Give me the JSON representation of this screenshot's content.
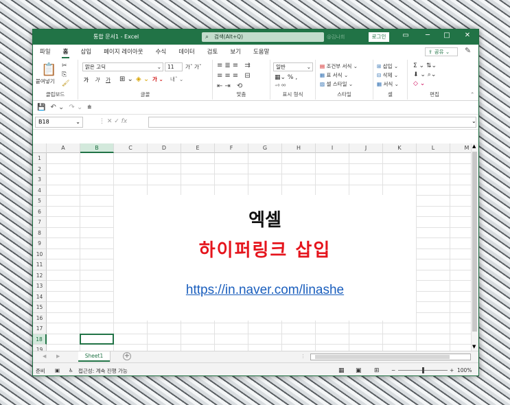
{
  "titlebar": {
    "doc_title": "통합 문서1 - Excel",
    "search_placeholder": "검색(Alt+Q)",
    "user": "@김나희",
    "signin_label": "로그인",
    "minimize": "─",
    "restore": "□",
    "close": "✕"
  },
  "menu": {
    "tabs": [
      "파일",
      "홈",
      "삽입",
      "페이지 레이아웃",
      "수식",
      "데이터",
      "검토",
      "보기",
      "도움말"
    ],
    "active_tab": "홈",
    "share_label": "공유"
  },
  "ribbon": {
    "clipboard": {
      "paste_label": "붙여넣기",
      "group_label": "클립보드"
    },
    "font": {
      "font_name": "맑은 고딕",
      "font_size": "11",
      "bold": "가",
      "italic": "가",
      "underline": "가",
      "group_label": "글꼴"
    },
    "alignment": {
      "group_label": "맞춤"
    },
    "number": {
      "format": "일반",
      "group_label": "표시 형식"
    },
    "styles": {
      "conditional": "조건부 서식",
      "table": "표 서식",
      "cell_styles": "셀 스타일",
      "group_label": "스타일"
    },
    "cells": {
      "insert": "삽입",
      "delete": "삭제",
      "format": "서식",
      "group_label": "셀"
    },
    "editing": {
      "group_label": "편집"
    }
  },
  "formula_bar": {
    "name_box": "B18",
    "fx": "fx",
    "formula": ""
  },
  "grid": {
    "columns": [
      "A",
      "B",
      "C",
      "D",
      "E",
      "F",
      "G",
      "H",
      "I",
      "J",
      "K",
      "L",
      "M"
    ],
    "rows": [
      "1",
      "2",
      "3",
      "4",
      "5",
      "6",
      "7",
      "8",
      "9",
      "10",
      "11",
      "12",
      "13",
      "14",
      "15",
      "16",
      "17",
      "18",
      "19"
    ],
    "selected_column": "B",
    "selected_row": "18"
  },
  "overlay": {
    "title": "엑셀",
    "subtitle": "하이퍼링크 삽입",
    "link": "https://in.naver.com/linashe"
  },
  "sheets": {
    "tabs": [
      "Sheet1"
    ],
    "add_label": "+"
  },
  "status": {
    "ready": "준비",
    "accessibility": "접근성: 계속 진행 가능",
    "zoom": "100%",
    "zoom_fraction": 0.5
  }
}
